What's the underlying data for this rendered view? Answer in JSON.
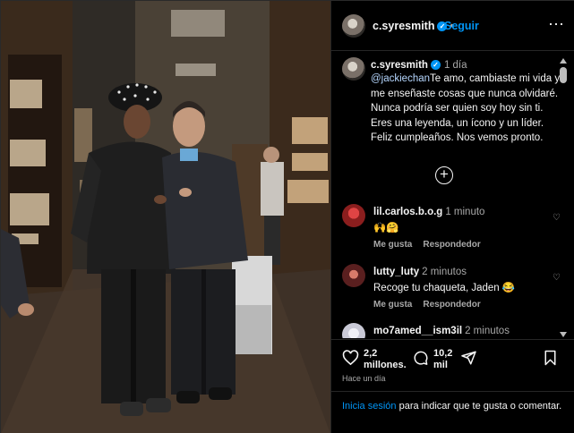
{
  "post": {
    "username": "c.syresmith",
    "follow_label": "Seguir",
    "caption_time": "1 día",
    "caption_mention": "@jackiechan",
    "caption_text": "Te amo, cambiaste mi vida y me enseñaste cosas que nunca olvidaré. Nunca podría ser quien soy hoy sin ti. Eres una leyenda, un ícono y un líder. Feliz cumpleaños. Nos vemos pronto.",
    "dot": "•",
    "more_glyph": "⋯",
    "verified_glyph": "✓"
  },
  "comments": [
    {
      "username": "lil.carlos.b.o.g",
      "time": "1 minuto",
      "text": "🙌🤗",
      "like_label": "Me gusta",
      "reply_label": "Respondedor",
      "avatar_color": "#8b1e1e"
    },
    {
      "username": "lutty_luty",
      "time": "2 minutos",
      "text": "Recoge tu chaqueta, Jaden 😂",
      "like_label": "Me gusta",
      "reply_label": "Respondedor",
      "avatar_color": "#5a1f1f"
    },
    {
      "username": "mo7amed__ism3il",
      "time": "2 minutos",
      "text": "",
      "like_label": "",
      "reply_label": "",
      "avatar_color": "#c9c9d6"
    }
  ],
  "stats": {
    "likes": "2,2 millones.",
    "comments": "10,2 mil",
    "time_ago": "Hace un día"
  },
  "login": {
    "link": "Inicia sesión",
    "rest": " para indicar que te gusta o comentar."
  },
  "icons": {
    "plus": "plus-circle-icon",
    "heart": "heart-icon",
    "comment": "comment-icon",
    "share": "share-icon",
    "save": "bookmark-icon"
  },
  "colors": {
    "accent": "#0095f6",
    "secondary_text": "#a8a8a8",
    "background": "#000000"
  }
}
